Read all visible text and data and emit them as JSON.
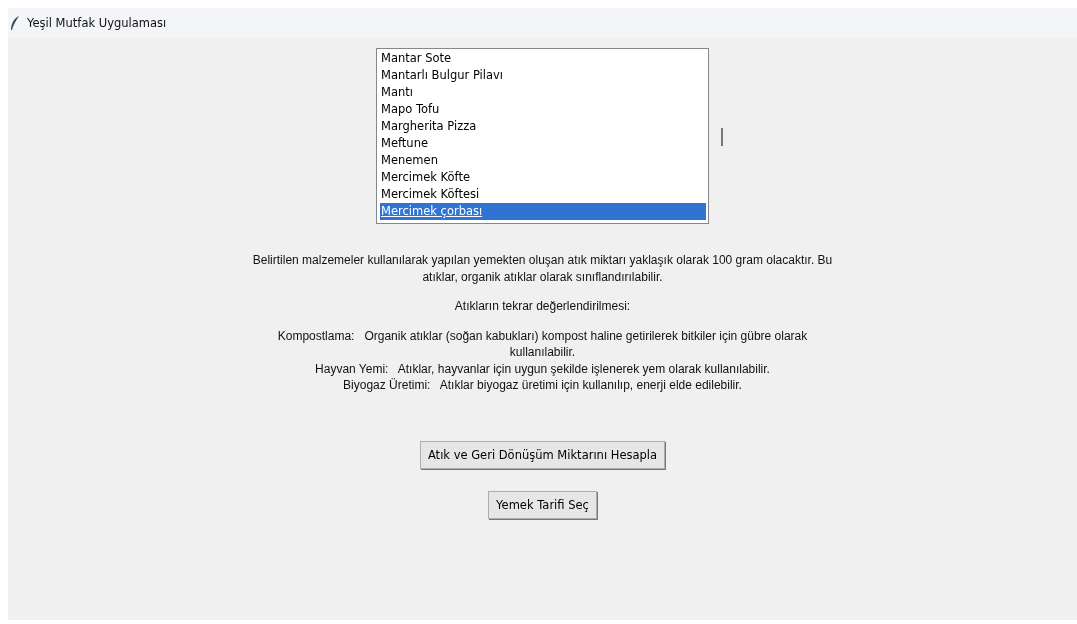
{
  "window": {
    "title": "Yeşil Mutfak Uygulaması"
  },
  "recipe_list": {
    "items": [
      {
        "label": "Mantar Sote",
        "selected": false
      },
      {
        "label": "Mantarlı Bulgur Pilavı",
        "selected": false
      },
      {
        "label": "Mantı",
        "selected": false
      },
      {
        "label": "Mapo Tofu",
        "selected": false
      },
      {
        "label": "Margherita Pizza",
        "selected": false
      },
      {
        "label": "Meftune",
        "selected": false
      },
      {
        "label": "Menemen",
        "selected": false
      },
      {
        "label": "Mercimek Köfte",
        "selected": false
      },
      {
        "label": "Mercimek Köftesi",
        "selected": false
      },
      {
        "label": "Mercimek çorbası",
        "selected": true
      }
    ]
  },
  "result_paragraphs": [
    [
      "Belirtilen malzemeler kullanılarak yapılan yemekten oluşan atık miktarı yaklaşık olarak 100 gram olacaktır. Bu atıklar, organik atıklar olarak sınıflandırılabilir."
    ],
    [
      "Atıkların tekrar değerlendirilmesi:"
    ],
    [
      "Kompostlama:   Organik atıklar (soğan kabukları) kompost haline getirilerek bitkiler için gübre olarak kullanılabilir.",
      "Hayvan Yemi:   Atıklar, hayvanlar için uygun şekilde işlenerek yem olarak kullanılabilir.",
      "Biyogaz Üretimi:   Atıklar biyogaz üretimi için kullanılıp, enerji elde edilebilir."
    ]
  ],
  "buttons": [
    "Atık ve Geri Dönüşüm Miktarını Hesapla",
    "Yemek Tarifi Seç"
  ]
}
